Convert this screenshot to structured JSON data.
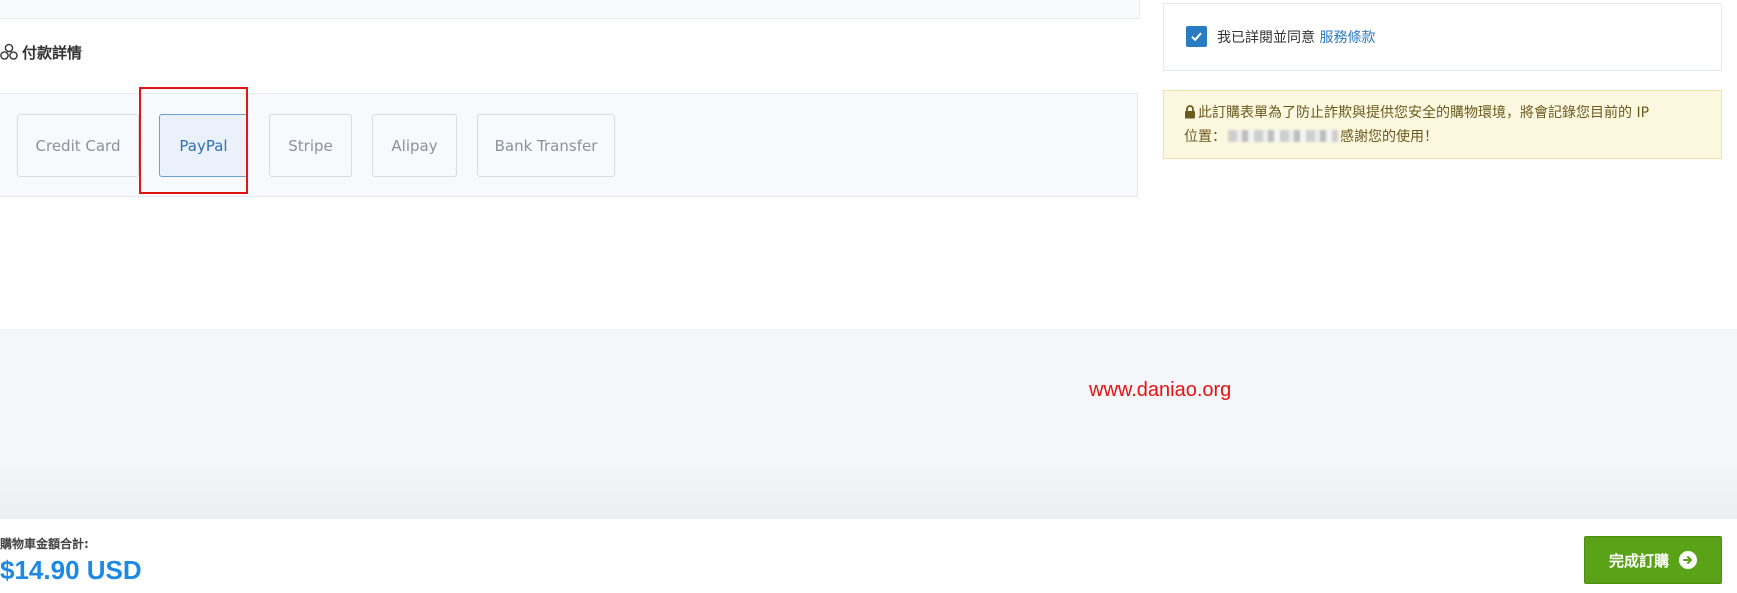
{
  "payment": {
    "section_title": "付款詳情",
    "options": [
      {
        "label": "Credit Card",
        "selected": false
      },
      {
        "label": "PayPal",
        "selected": true
      },
      {
        "label": "Stripe",
        "selected": false
      },
      {
        "label": "Alipay",
        "selected": false
      },
      {
        "label": "Bank Transfer",
        "selected": false
      }
    ]
  },
  "terms": {
    "checked": true,
    "text": "我已詳閱並同意",
    "link_text": "服務條款"
  },
  "ip_notice": {
    "line1": "此訂購表單為了防止詐欺與提供您安全的購物環境，將會記錄您目前的 IP",
    "line2_prefix": "位置：",
    "line2_suffix": "感謝您的使用！"
  },
  "watermark": "www.daniao.org",
  "footer": {
    "total_label": "購物車金額合計:",
    "total_value": "$14.90 USD",
    "complete_button": "完成訂購"
  },
  "colors": {
    "accent": "#2b7bc2",
    "total": "#1e88e5",
    "button": "#5aa217",
    "highlight": "#e51414",
    "watermark": "#e41313"
  }
}
